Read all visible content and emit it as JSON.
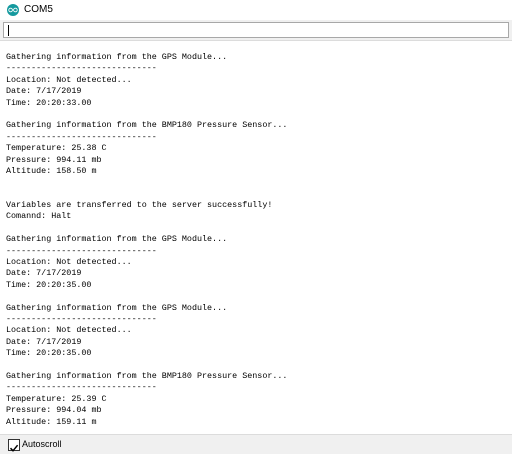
{
  "window": {
    "title": "COM5",
    "icon": "arduino-icon",
    "accent": "#14999e"
  },
  "send_input": {
    "value": ""
  },
  "output": {
    "lines": [
      "Gathering information from the GPS Module...",
      "------------------------------",
      "Location: Not detected...",
      "Date: 7/17/2019",
      "Time: 20:20:33.00",
      "",
      "Gathering information from the BMP180 Pressure Sensor...",
      "------------------------------",
      "Temperature: 25.38 C",
      "Pressure: 994.11 mb",
      "Altitude: 158.50 m",
      "",
      "",
      "Variables are transferred to the server successfully!",
      "Comannd: Halt",
      "",
      "Gathering information from the GPS Module...",
      "------------------------------",
      "Location: Not detected...",
      "Date: 7/17/2019",
      "Time: 20:20:35.00",
      "",
      "Gathering information from the GPS Module...",
      "------------------------------",
      "Location: Not detected...",
      "Date: 7/17/2019",
      "Time: 20:20:35.00",
      "",
      "Gathering information from the BMP180 Pressure Sensor...",
      "------------------------------",
      "Temperature: 25.39 C",
      "Pressure: 994.04 mb",
      "Altitude: 159.11 m"
    ]
  },
  "footer": {
    "autoscroll_label": "Autoscroll",
    "autoscroll_checked": true
  }
}
